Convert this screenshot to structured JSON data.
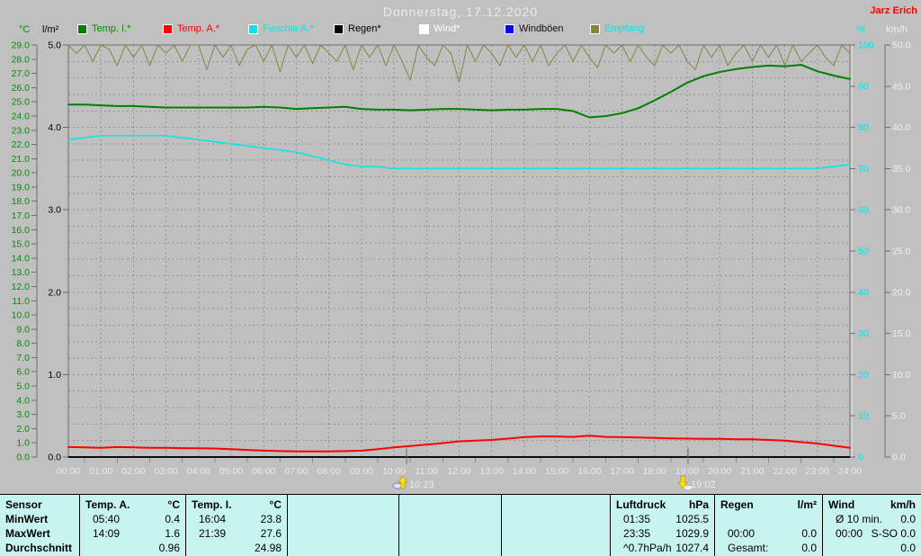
{
  "header": {
    "title": "Donnerstag, 17.12.2020",
    "owner": "Jarz Erich"
  },
  "colors": {
    "background": "#c0c0c0",
    "table_bg": "#c8f4ef",
    "grid": "#949494",
    "axis_line": "#6e6e6e",
    "axis_highlight": "#e8e8e8",
    "axis_bottom": "#1c1c1c",
    "title_text": "#ececec",
    "time_text": "#ececec",
    "marker_text": "#ececec",
    "owner_text": "#ff0000",
    "marker_arrow": "#ffe000"
  },
  "legend": [
    {
      "label": "Temp. I.*",
      "swatch": "#008000",
      "text_color": "#009000"
    },
    {
      "label": "Temp. A.*",
      "swatch": "#ff0000",
      "text_color": "#ff0000"
    },
    {
      "label": "Feuchte A.*",
      "swatch": "#00e8e8",
      "text_color": "#00e8e8"
    },
    {
      "label": "Regen*",
      "swatch": "#000000",
      "text_color": "#000000"
    },
    {
      "label": "Wind*",
      "swatch": "#ffffff",
      "text_color": "#ffffff"
    },
    {
      "label": "Windböen",
      "swatch": "#0000ff",
      "text_color": "#101010"
    },
    {
      "label": "Empfang",
      "swatch": "#85853e",
      "text_color": "#00e8e8"
    }
  ],
  "chart_data": {
    "type": "line",
    "title": "Donnerstag, 17.12.2020",
    "grid": {
      "horizontal_step_lm2": 0.2,
      "vertical_step_hours": 1
    },
    "x_axis": {
      "range_hours": [
        0,
        24
      ],
      "tick_labels": [
        "00:00",
        "01:00",
        "02:00",
        "03:00",
        "04:00",
        "05:00",
        "06:00",
        "07:00",
        "08:00",
        "09:00",
        "10:00",
        "11:00",
        "12:00",
        "13:00",
        "14:00",
        "15:00",
        "16:00",
        "17:00",
        "18:00",
        "19:00",
        "20:00",
        "21:00",
        "22:00",
        "23:00",
        "24:00"
      ]
    },
    "y_axes": [
      {
        "id": "temp_c",
        "unit": "°C",
        "color": "#009000",
        "range": [
          0,
          29
        ],
        "tick_step": 1,
        "decimals": 1
      },
      {
        "id": "rain_lm2",
        "unit": "l/m²",
        "color": "#000000",
        "range": [
          0,
          5
        ],
        "tick_step": 1,
        "decimals": 1
      },
      {
        "id": "humidity_pct",
        "unit": "%",
        "color": "#00e8e8",
        "range": [
          0,
          100
        ],
        "tick_step": 10,
        "decimals": 0
      },
      {
        "id": "wind_kmh",
        "unit": "km/h",
        "color": "#f0f0f0",
        "range": [
          0,
          50
        ],
        "tick_step": 5,
        "decimals": 1
      }
    ],
    "series": [
      {
        "name": "Temp. I.*",
        "axis": "temp_c",
        "color": "#008000",
        "width": 2,
        "x_start": 0,
        "x_step": 0.5,
        "values": [
          24.8,
          24.8,
          24.75,
          24.7,
          24.7,
          24.65,
          24.6,
          24.6,
          24.6,
          24.6,
          24.6,
          24.6,
          24.65,
          24.6,
          24.5,
          24.55,
          24.6,
          24.65,
          24.5,
          24.45,
          24.45,
          24.4,
          24.45,
          24.5,
          24.5,
          24.45,
          24.4,
          24.45,
          24.45,
          24.5,
          24.5,
          24.35,
          23.9,
          24.0,
          24.2,
          24.55,
          25.1,
          25.7,
          26.35,
          26.8,
          27.1,
          27.3,
          27.45,
          27.55,
          27.5,
          27.6,
          27.15,
          26.85,
          26.6
        ]
      },
      {
        "name": "Temp. A.*",
        "axis": "temp_c",
        "color": "#ff0000",
        "width": 2,
        "x_start": 0,
        "x_step": 0.5,
        "values": [
          0.7,
          0.68,
          0.65,
          0.7,
          0.68,
          0.65,
          0.65,
          0.63,
          0.62,
          0.6,
          0.55,
          0.5,
          0.45,
          0.42,
          0.4,
          0.4,
          0.4,
          0.42,
          0.45,
          0.55,
          0.68,
          0.78,
          0.88,
          0.98,
          1.1,
          1.15,
          1.2,
          1.3,
          1.4,
          1.45,
          1.45,
          1.42,
          1.5,
          1.42,
          1.4,
          1.38,
          1.35,
          1.32,
          1.3,
          1.28,
          1.28,
          1.25,
          1.25,
          1.2,
          1.15,
          1.05,
          0.95,
          0.8,
          0.65
        ]
      },
      {
        "name": "Feuchte A.*",
        "axis": "humidity_pct",
        "color": "#00e8e8",
        "width": 1.5,
        "x_start": 0,
        "x_step": 0.5,
        "values": [
          77,
          77.5,
          78,
          78,
          78,
          78,
          78,
          77.5,
          77,
          76.5,
          76,
          75.5,
          75,
          74.5,
          74,
          73,
          72,
          71,
          70.5,
          70.5,
          70,
          70,
          70,
          70,
          70,
          70,
          70,
          70,
          70,
          70,
          70,
          70,
          70,
          70,
          70,
          70,
          70,
          70,
          70,
          70,
          70,
          70,
          70,
          70,
          70,
          70,
          70,
          70.5,
          71
        ]
      },
      {
        "name": "Regen*",
        "axis": "rain_lm2",
        "color": "#000000",
        "width": 1,
        "x_start": 0,
        "x_step": 24,
        "values": [
          0,
          0
        ]
      },
      {
        "name": "Wind*",
        "axis": "wind_kmh",
        "color": "#ffffff",
        "width": 1,
        "x_start": 0,
        "x_step": 24,
        "values": [
          0,
          0
        ]
      },
      {
        "name": "Windböen",
        "axis": "wind_kmh",
        "color": "#0000ff",
        "width": 1,
        "x_start": 0,
        "x_step": 24,
        "values": [
          0,
          0
        ]
      },
      {
        "name": "Empfang",
        "axis": "humidity_pct",
        "color": "#85853e",
        "width": 1,
        "x_start": 0,
        "x_step": 0.25,
        "values": [
          100,
          98,
          100,
          96,
          100,
          99,
          95,
          100,
          97,
          100,
          95,
          100,
          98,
          100,
          96,
          100,
          100,
          94,
          100,
          97,
          100,
          95,
          99,
          100,
          96,
          100,
          93.5,
          100,
          97,
          100,
          95.5,
          100,
          98,
          96,
          100,
          94,
          100,
          97,
          100,
          95,
          100,
          96,
          91.5,
          100,
          97,
          95,
          100,
          98,
          91,
          100,
          96,
          100,
          98,
          95,
          100,
          97,
          100,
          96,
          100,
          95,
          98,
          100,
          96,
          100,
          97,
          94.5,
          100,
          98,
          100,
          96,
          100,
          97,
          95,
          100,
          98,
          100,
          96,
          94,
          100,
          97,
          100,
          95,
          98,
          100,
          96,
          100,
          97,
          100,
          95,
          100,
          96,
          98,
          100,
          97,
          95,
          100,
          98
        ]
      }
    ],
    "markers": [
      {
        "label": "10:23",
        "hour": 10.383,
        "direction": "up",
        "icon": "moonrise-icon"
      },
      {
        "label": "19:02",
        "hour": 19.033,
        "direction": "down",
        "icon": "moonset-icon"
      }
    ]
  },
  "table": {
    "row_labels": [
      "Sensor",
      "MinWert",
      "MaxWert",
      "Durchschnitt"
    ],
    "columns": [
      {
        "name": "Temp. A.",
        "unit": "°C",
        "min": [
          "05:40",
          "0.4"
        ],
        "max": [
          "14:09",
          "1.6"
        ],
        "avg": [
          "",
          "0.96"
        ]
      },
      {
        "name": "Temp. I.",
        "unit": "°C",
        "min": [
          "16:04",
          "23.8"
        ],
        "max": [
          "21:39",
          "27.6"
        ],
        "avg": [
          "",
          "24.98"
        ]
      },
      {
        "name": "",
        "unit": "",
        "min": [
          "",
          ""
        ],
        "max": [
          "",
          ""
        ],
        "avg": [
          "",
          ""
        ]
      },
      {
        "name": "",
        "unit": "",
        "min": [
          "",
          ""
        ],
        "max": [
          "",
          ""
        ],
        "avg": [
          "",
          ""
        ]
      },
      {
        "name": "",
        "unit": "",
        "min": [
          "",
          ""
        ],
        "max": [
          "",
          ""
        ],
        "avg": [
          "",
          ""
        ]
      },
      {
        "name": "Luftdruck",
        "unit": "hPa",
        "min": [
          "01:35",
          "1025.5"
        ],
        "max": [
          "23:35",
          "1029.9"
        ],
        "avg": [
          "^0.7hPa/h",
          "1027.4"
        ]
      },
      {
        "name": "Regen",
        "unit": "l/m²",
        "min": [
          "",
          ""
        ],
        "max": [
          "00:00",
          "0.0"
        ],
        "avg": [
          "Gesamt:",
          "0.0"
        ]
      },
      {
        "name": "Wind",
        "unit": "km/h",
        "min": [
          "Ø 10 min.",
          "0.0"
        ],
        "max": [
          "00:00",
          "S-SO 0.0"
        ],
        "avg": [
          "",
          "0.0"
        ]
      }
    ]
  }
}
